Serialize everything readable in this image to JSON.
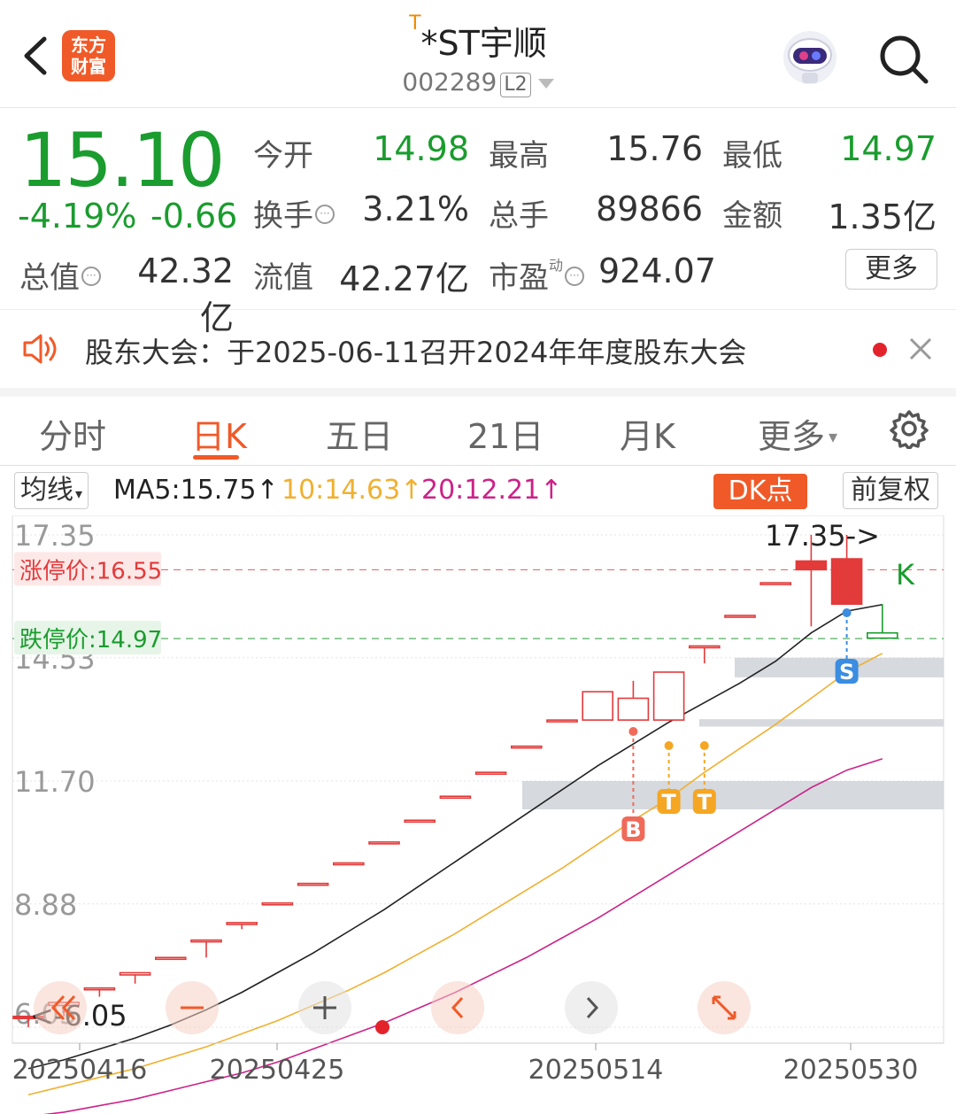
{
  "header": {
    "logo_line1": "东方",
    "logo_line2": "财富",
    "st_mark": "T",
    "stock_name": "*ST宇顺",
    "stock_code": "002289",
    "level_badge": "L2"
  },
  "quote": {
    "price": "15.10",
    "change_pct": "-4.19%",
    "change_abs": "-0.66",
    "open_label": "今开",
    "open_value": "14.98",
    "high_label": "最高",
    "high_value": "15.76",
    "low_label": "最低",
    "low_value": "14.97",
    "turnover_label": "换手",
    "turnover_value": "3.21%",
    "volume_label": "总手",
    "volume_value": "89866",
    "amount_label": "金额",
    "amount_value": "1.35亿",
    "mktcap_label": "总值",
    "mktcap_value": "42.32亿",
    "float_label": "流值",
    "float_value": "42.27亿",
    "pe_label": "市盈",
    "pe_sup": "动",
    "pe_value": "924.07",
    "more_label": "更多"
  },
  "notice": {
    "text": "股东大会：于2025-06-11召开2024年年度股东大会"
  },
  "tabs": [
    "分时",
    "日K",
    "五日",
    "21日",
    "月K",
    "更多"
  ],
  "active_tab": "日K",
  "ma_bar": {
    "selector": "均线",
    "ma5": "MA5:15.75↑",
    "ma10": "10:14.63↑",
    "ma20": "20:12.21↑",
    "dk_label": "DK点",
    "adjust_label": "前复权"
  },
  "colors": {
    "up": "#e33a3a",
    "down": "#1a9c2e",
    "accent": "#f05a28",
    "ma5": "#222222",
    "ma10": "#f0b030",
    "ma20": "#cc2288"
  },
  "chart_data": {
    "type": "candlestick",
    "y_ticks": [
      "17.35",
      "14.53",
      "11.70",
      "8.88",
      "6.05"
    ],
    "x_ticks": [
      "20250416",
      "20250425",
      "20250514",
      "20250530"
    ],
    "limit_up_label": "涨停价:16.55",
    "limit_down_label": "跌停价:14.97",
    "max_label": "17.35->",
    "min_label": "<-6.05",
    "signals": [
      "B",
      "T",
      "T",
      "S",
      "K"
    ],
    "candles": [
      {
        "o": 6.25,
        "h": 6.3,
        "l": 6.05,
        "c": 6.3
      },
      {
        "o": 6.55,
        "h": 6.62,
        "l": 6.3,
        "c": 6.62
      },
      {
        "o": 6.95,
        "h": 6.95,
        "l": 6.75,
        "c": 6.95
      },
      {
        "o": 7.25,
        "h": 7.3,
        "l": 7.05,
        "c": 7.3
      },
      {
        "o": 7.65,
        "h": 7.65,
        "l": 7.65,
        "c": 7.65
      },
      {
        "o": 8.05,
        "h": 8.05,
        "l": 7.65,
        "c": 8.05
      },
      {
        "o": 8.45,
        "h": 8.45,
        "l": 8.3,
        "c": 8.45
      },
      {
        "o": 8.88,
        "h": 8.9,
        "l": 8.85,
        "c": 8.9
      },
      {
        "o": 9.35,
        "h": 9.35,
        "l": 9.35,
        "c": 9.35
      },
      {
        "o": 9.82,
        "h": 9.82,
        "l": 9.82,
        "c": 9.82
      },
      {
        "o": 10.3,
        "h": 10.3,
        "l": 10.3,
        "c": 10.3
      },
      {
        "o": 10.8,
        "h": 10.8,
        "l": 10.8,
        "c": 10.8
      },
      {
        "o": 11.35,
        "h": 11.35,
        "l": 11.35,
        "c": 11.35
      },
      {
        "o": 11.9,
        "h": 11.9,
        "l": 11.9,
        "c": 11.9
      },
      {
        "o": 12.5,
        "h": 12.5,
        "l": 12.5,
        "c": 12.5
      },
      {
        "o": 13.1,
        "h": 13.1,
        "l": 13.1,
        "c": 13.1
      },
      {
        "o": 13.1,
        "h": 13.75,
        "l": 13.1,
        "c": 13.75
      },
      {
        "o": 13.1,
        "h": 14.0,
        "l": 13.1,
        "c": 13.6
      },
      {
        "o": 13.1,
        "h": 14.2,
        "l": 13.1,
        "c": 14.2
      },
      {
        "o": 14.8,
        "h": 14.8,
        "l": 14.4,
        "c": 14.8
      },
      {
        "o": 15.5,
        "h": 15.5,
        "l": 15.5,
        "c": 15.5
      },
      {
        "o": 16.25,
        "h": 16.25,
        "l": 16.25,
        "c": 16.25
      },
      {
        "o": 16.75,
        "h": 17.35,
        "l": 15.25,
        "c": 16.55
      },
      {
        "o": 16.8,
        "h": 17.35,
        "l": 15.76,
        "c": 15.76
      },
      {
        "o": 14.98,
        "h": 15.76,
        "l": 14.97,
        "c": 15.1
      }
    ],
    "ma5": [
      5.1,
      5.3,
      5.55,
      5.8,
      6.1,
      6.45,
      6.85,
      7.3,
      7.75,
      8.25,
      8.75,
      9.3,
      9.85,
      10.4,
      10.95,
      11.5,
      12.05,
      12.55,
      13.05,
      13.5,
      13.95,
      14.45,
      15.1,
      15.6,
      15.75
    ],
    "ma10": [
      4.5,
      4.7,
      4.9,
      5.1,
      5.35,
      5.6,
      5.9,
      6.2,
      6.55,
      6.9,
      7.3,
      7.75,
      8.2,
      8.7,
      9.2,
      9.7,
      10.25,
      10.8,
      11.3,
      11.9,
      12.45,
      13.0,
      13.6,
      14.2,
      14.63
    ],
    "ma20": [
      4.0,
      4.1,
      4.25,
      4.4,
      4.6,
      4.8,
      5.0,
      5.25,
      5.55,
      5.85,
      6.15,
      6.5,
      6.85,
      7.25,
      7.65,
      8.1,
      8.55,
      9.05,
      9.55,
      10.05,
      10.55,
      11.05,
      11.55,
      11.95,
      12.21
    ]
  }
}
